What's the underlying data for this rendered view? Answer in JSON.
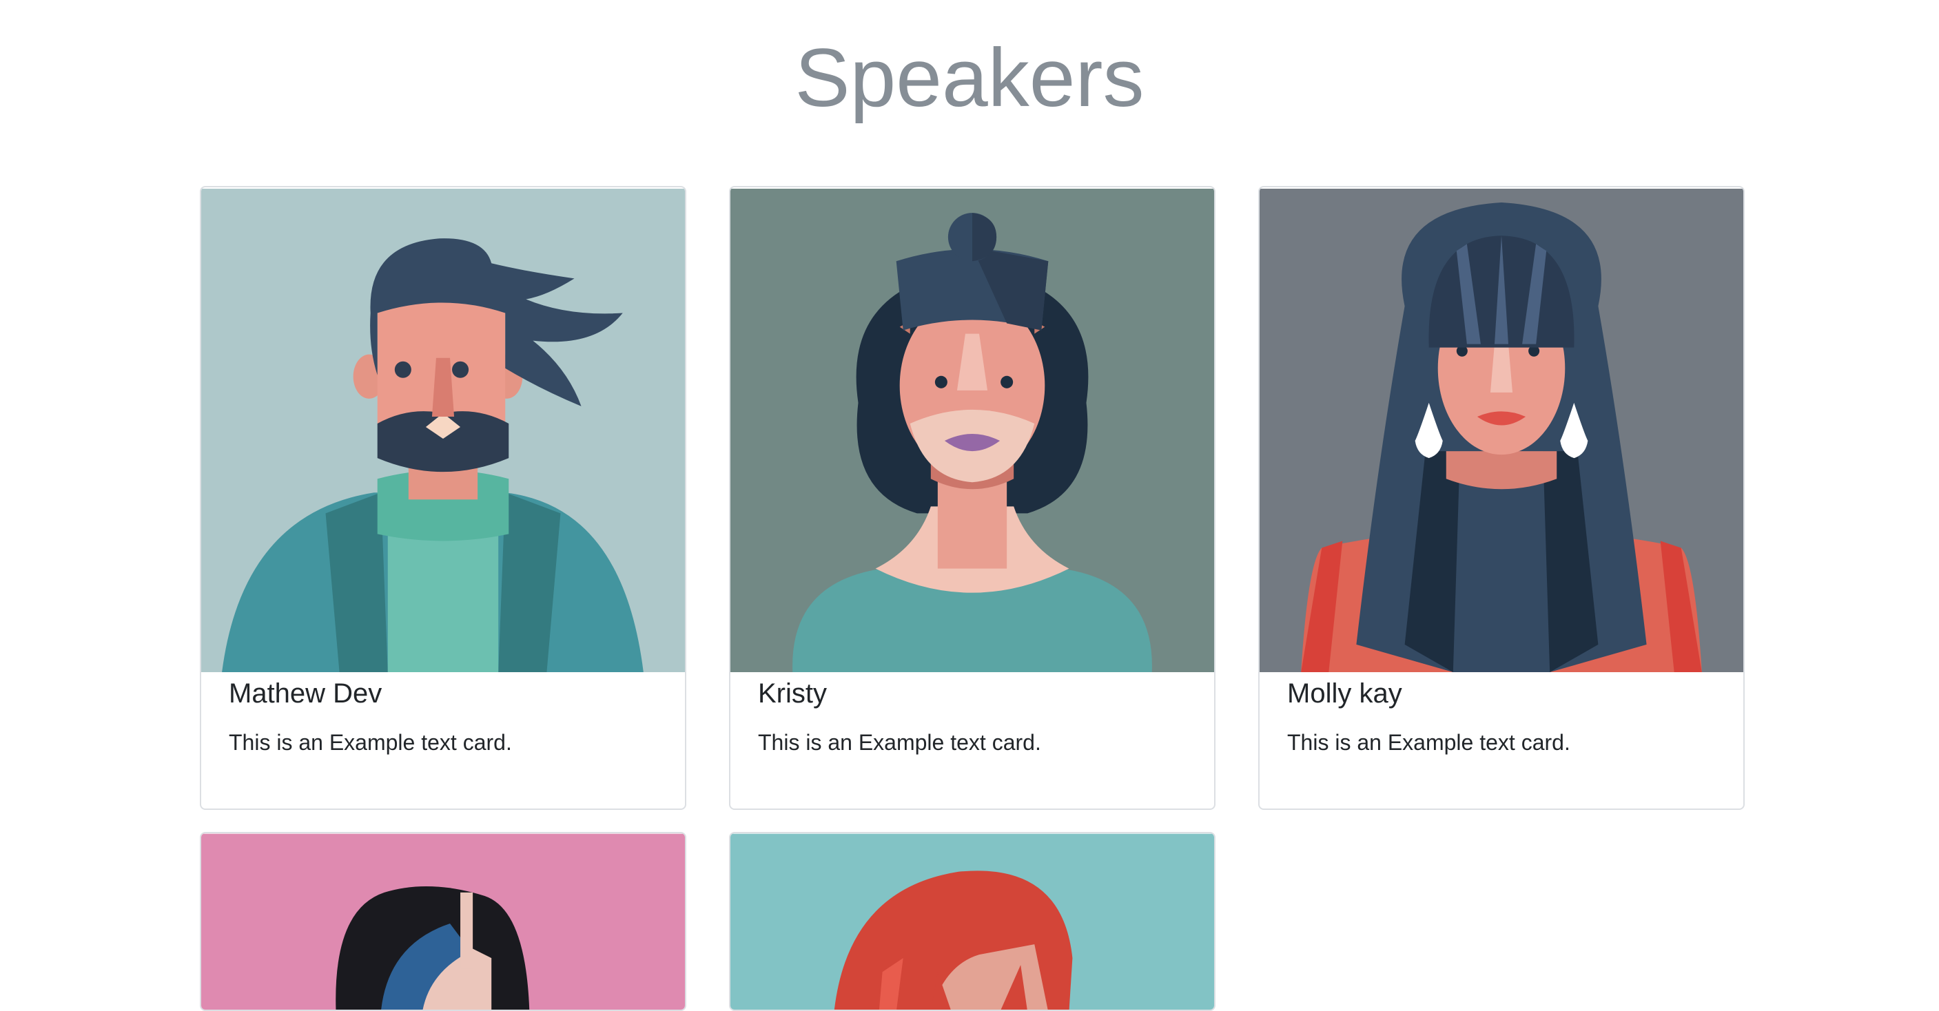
{
  "page": {
    "title": "Speakers"
  },
  "speakers": [
    {
      "name": "Mathew Dev",
      "text": "This is an Example text card.",
      "avatar_bg": "#aec8ca",
      "avatar": "bearded-man-avatar"
    },
    {
      "name": "Kristy",
      "text": "This is an Example text card.",
      "avatar_bg": "#728985",
      "avatar": "woman-hair-bun-avatar"
    },
    {
      "name": "Molly kay",
      "text": "This is an Example text card.",
      "avatar_bg": "#737a82",
      "avatar": "woman-long-hair-avatar"
    },
    {
      "avatar_bg": "#df8ab0",
      "avatar": "dark-hair-person-avatar"
    },
    {
      "avatar_bg": "#82c3c5",
      "avatar": "red-hair-person-avatar"
    }
  ],
  "colors": {
    "title": "#868e96",
    "text": "#212529",
    "card_border": "#dcdfe3"
  }
}
